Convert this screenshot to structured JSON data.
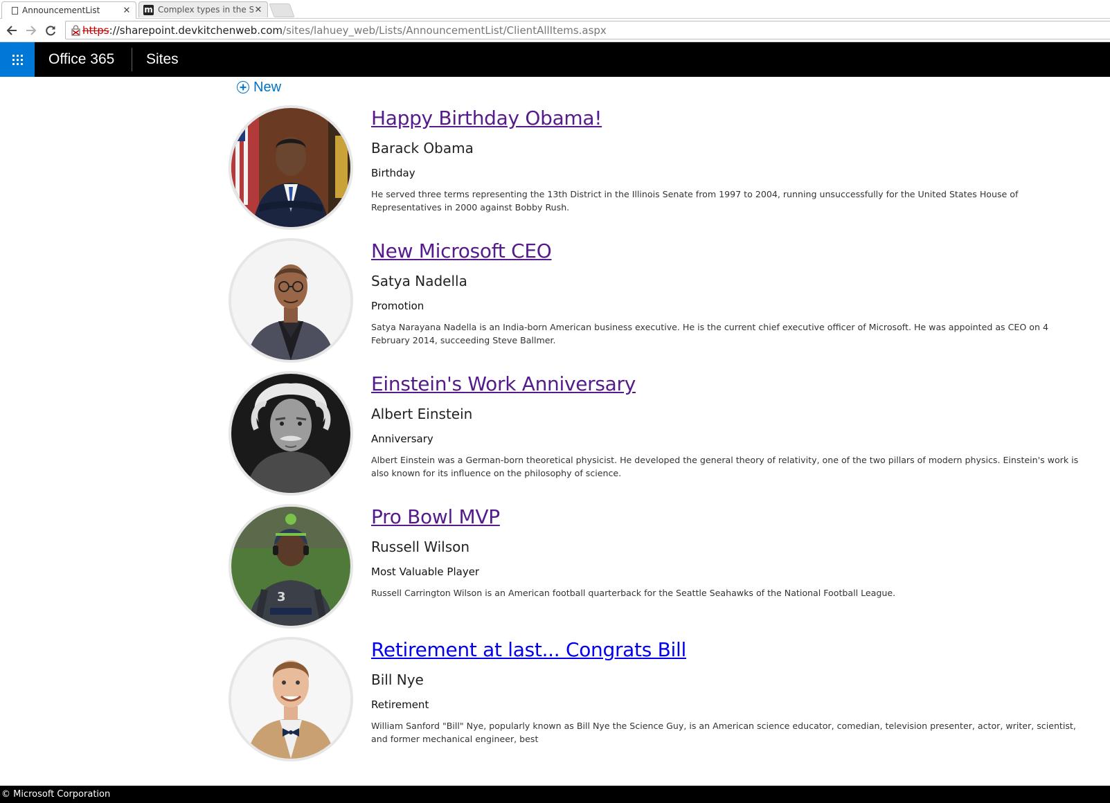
{
  "browser": {
    "tabs": [
      {
        "title": "AnnouncementList",
        "active": true
      },
      {
        "title": "Complex types in the SP n",
        "active": false
      }
    ],
    "address": {
      "scheme": "https",
      "host": "://sharepoint.devkitchenweb.com",
      "path": "/sites/lahuey_web/Lists/AnnouncementList/ClientAllItems.aspx"
    }
  },
  "suitebar": {
    "brand": "Office 365",
    "nav_link": "Sites",
    "accent_color": "#0078d7"
  },
  "list": {
    "new_label": "New",
    "items": [
      {
        "title": "Happy Birthday Obama!",
        "person": "Barack Obama",
        "category": "Birthday",
        "description": "He served three terms representing the 13th District in the Illinois Senate from 1997 to 2004, running unsuccessfully for the United States House of Representatives in 2000 against Bobby Rush.",
        "visited": true
      },
      {
        "title": "New Microsoft CEO",
        "person": "Satya Nadella",
        "category": "Promotion",
        "description": "Satya Narayana Nadella is an India-born American business executive. He is the current chief executive officer of Microsoft. He was appointed as CEO on 4 February 2014, succeeding Steve Ballmer.",
        "visited": true
      },
      {
        "title": "Einstein's Work Anniversary",
        "person": "Albert Einstein",
        "category": "Anniversary",
        "description": "Albert Einstein was a German-born theoretical physicist. He developed the general theory of relativity, one of the two pillars of modern physics. Einstein's work is also known for its influence on the philosophy of science.",
        "visited": true
      },
      {
        "title": "Pro Bowl MVP",
        "person": "Russell Wilson",
        "category": "Most Valuable Player",
        "description": "Russell Carrington Wilson is an American football quarterback for the Seattle Seahawks of the National Football League.",
        "visited": true
      },
      {
        "title": "Retirement at last... Congrats Bill",
        "person": "Bill Nye",
        "category": "Retirement",
        "description": "William Sanford \"Bill\" Nye, popularly known as Bill Nye the Science Guy, is an American science educator, comedian, television presenter, actor, writer, scientist, and former mechanical engineer, best",
        "visited": false
      }
    ]
  },
  "footer": {
    "text": "© Microsoft Corporation"
  }
}
